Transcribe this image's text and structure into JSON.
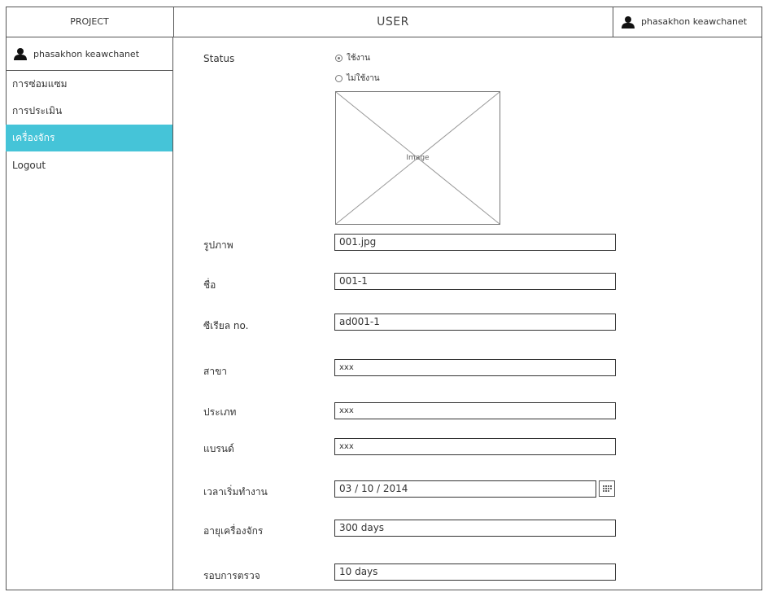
{
  "header": {
    "project": "PROJECT",
    "title": "USER",
    "user": "phasakhon keawchanet"
  },
  "sidebar": {
    "user": "phasakhon keawchanet",
    "items": [
      {
        "label": "การซ่อมแซม",
        "active": false
      },
      {
        "label": "การประเมิน",
        "active": false
      },
      {
        "label": "เครื่องจักร",
        "active": true
      },
      {
        "label": "Logout",
        "active": false
      }
    ],
    "active_color": "#45c4d8"
  },
  "form": {
    "status_label": "Status",
    "status_options": [
      {
        "label": "ใช้งาน",
        "checked": true
      },
      {
        "label": "ไม่ใช้งาน",
        "checked": false
      }
    ],
    "image_placeholder": "Image",
    "fields": {
      "picture": {
        "label": "รูปภาพ",
        "value": "001.jpg"
      },
      "name": {
        "label": "ชื่อ",
        "value": "001-1"
      },
      "serial": {
        "label": "ซีเรียล no.",
        "value": "ad001-1"
      },
      "branch": {
        "label": "สาขา",
        "value": "xxx"
      },
      "type": {
        "label": "ประเภท",
        "value": "xxx"
      },
      "brand": {
        "label": "แบรนด์",
        "value": "xxx"
      },
      "start_date": {
        "label": "เวลาเริ่มทำงาน",
        "value": "03 / 10 / 2014"
      },
      "age": {
        "label": "อายุเครื่องจักร",
        "value": "300 days"
      },
      "inspection": {
        "label": "รอบการตรวจ",
        "value": "10 days"
      }
    }
  },
  "icons": {
    "user": "user-icon",
    "calendar": "calendar-icon"
  }
}
